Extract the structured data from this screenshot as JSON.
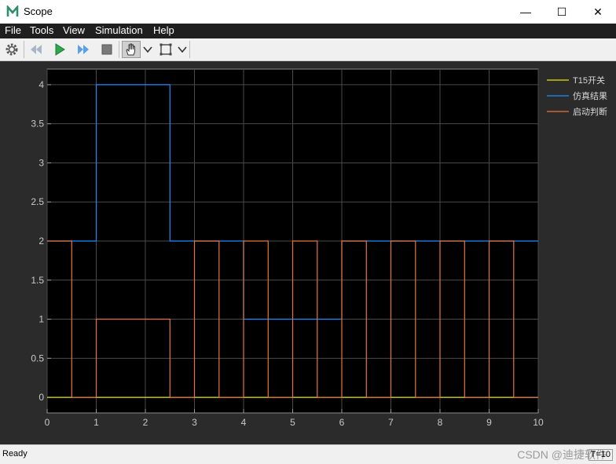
{
  "window": {
    "title": "Scope",
    "minimize_glyph": "—",
    "maximize_glyph": "☐",
    "close_glyph": "✕"
  },
  "menu": [
    "File",
    "Tools",
    "View",
    "Simulation",
    "Help"
  ],
  "toolbar": {
    "icons": [
      "gear-icon",
      "step-back-icon",
      "run-icon",
      "step-forward-icon",
      "stop-icon",
      "pan-hand-icon",
      "zoom-box-icon"
    ]
  },
  "status": {
    "text": "Ready",
    "right_text": "T=10"
  },
  "watermark": "CSDN @迪捷软件",
  "chart_data": {
    "type": "line",
    "step": true,
    "xlim": [
      0,
      10
    ],
    "ylim": [
      -0.2,
      4.2
    ],
    "xticks": [
      0,
      1,
      2,
      3,
      4,
      5,
      6,
      7,
      8,
      9,
      10
    ],
    "yticks": [
      0,
      0.5,
      1,
      1.5,
      2,
      2.5,
      3,
      3.5,
      4
    ],
    "grid": true,
    "legend_position": "top-right",
    "colors": {
      "background": "#000000",
      "grid": "#4a4a4a",
      "axis_text": "#c8c8c8"
    },
    "series": [
      {
        "name": "T15开关",
        "color": "#e8e800",
        "points": [
          [
            0,
            0
          ],
          [
            10,
            0
          ]
        ]
      },
      {
        "name": "仿真结果",
        "color": "#1a8cff",
        "points": [
          [
            0,
            2
          ],
          [
            1,
            2
          ],
          [
            1,
            4
          ],
          [
            2.5,
            4
          ],
          [
            2.5,
            2
          ],
          [
            4,
            2
          ],
          [
            4,
            1
          ],
          [
            6,
            1
          ],
          [
            6,
            2
          ],
          [
            10,
            2
          ]
        ]
      },
      {
        "name": "启动判断",
        "color": "#e8743b",
        "points": [
          [
            0,
            2
          ],
          [
            0.5,
            2
          ],
          [
            0.5,
            0
          ],
          [
            1,
            0
          ],
          [
            1,
            1
          ],
          [
            2.5,
            1
          ],
          [
            2.5,
            0
          ],
          [
            3,
            0
          ],
          [
            3,
            2
          ],
          [
            3.5,
            2
          ],
          [
            3.5,
            0
          ],
          [
            4,
            0
          ],
          [
            4,
            2
          ],
          [
            4.5,
            2
          ],
          [
            4.5,
            0
          ],
          [
            5,
            0
          ],
          [
            5,
            2
          ],
          [
            5.5,
            2
          ],
          [
            5.5,
            0
          ],
          [
            6,
            0
          ],
          [
            6,
            2
          ],
          [
            6.5,
            2
          ],
          [
            6.5,
            0
          ],
          [
            7,
            0
          ],
          [
            7,
            2
          ],
          [
            7.5,
            2
          ],
          [
            7.5,
            0
          ],
          [
            8,
            0
          ],
          [
            8,
            2
          ],
          [
            8.5,
            2
          ],
          [
            8.5,
            0
          ],
          [
            9,
            0
          ],
          [
            9,
            2
          ],
          [
            9.5,
            2
          ],
          [
            9.5,
            0
          ],
          [
            10,
            0
          ]
        ]
      }
    ]
  }
}
